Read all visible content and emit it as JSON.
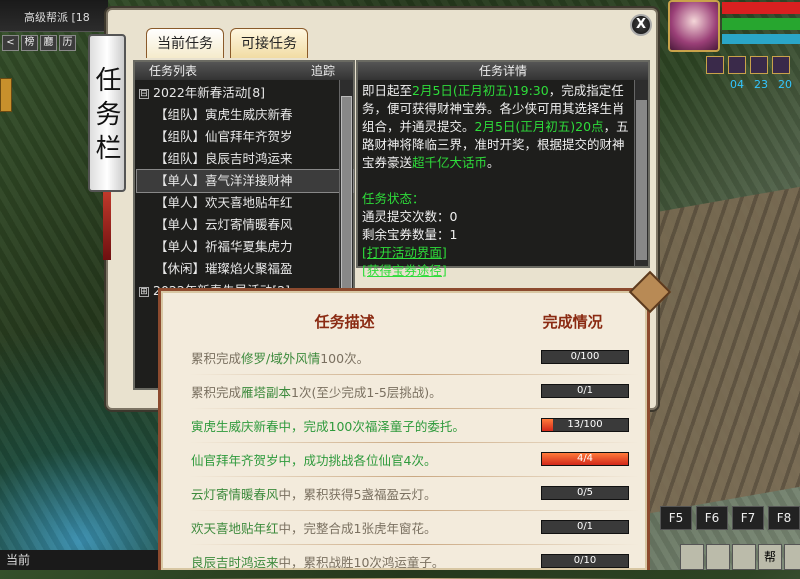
{
  "topbar": {
    "guild": "高级帮派 [18"
  },
  "toolrow": {
    "b1": "<",
    "b2": "榜",
    "b3": "廳",
    "b4": "历"
  },
  "window": {
    "title_scroll": "任务栏",
    "close": "X"
  },
  "tabs": [
    {
      "label": "当前任务"
    },
    {
      "label": "可接任务"
    }
  ],
  "list": {
    "header_left": "任务列表",
    "header_right": "追踪",
    "rows": [
      {
        "label": "2022年新春活动[8]",
        "expander": "⊟"
      },
      {
        "label": "【组队】寅虎生威庆新春"
      },
      {
        "label": "【组队】仙官拜年齐贺岁"
      },
      {
        "label": "【组队】良辰吉时鸿运来"
      },
      {
        "label": "【单人】喜气洋洋接财神"
      },
      {
        "label": "【单人】欢天喜地贴年红"
      },
      {
        "label": "【单人】云灯寄情暖春风"
      },
      {
        "label": "【单人】祈福华夏集虎力"
      },
      {
        "label": "【休闲】璀璨焰火聚福盈"
      },
      {
        "label": "2022年新春先导活动[2]",
        "expander": "⊞"
      }
    ]
  },
  "details": {
    "header": "任务详情",
    "p1a": "即日起至",
    "p1b": "2月5日(正月初五)19:30",
    "p1c": "，完成指定任务，便可获得财神宝券。各少侠可用其选择生肖组合，并通灵提交。",
    "p1d": "2月5日(正月初五)20点",
    "p1e": "，五路财神将降临三界，准时开奖，根据提交的财神宝券豪送",
    "p1f": "超千亿大话币",
    "p1g": "。",
    "status_label": "任务状态：",
    "s1": "通灵提交次数：0",
    "s2": "剩余宝券数量：1",
    "link1": "[打开活动界面]",
    "link2": "[获得宝券途径]"
  },
  "popup": {
    "col_desc": "任务描述",
    "col_status": "完成情况",
    "rows": [
      {
        "pre": "累积完成",
        "hl": "修罗/域外风情",
        "post": "100次。",
        "progress": "0/100",
        "frac": 0
      },
      {
        "pre": "累积完成",
        "hl": "雁塔副本",
        "post": "1次(至少完成1-5层挑战)。",
        "progress": "0/1",
        "frac": 0
      },
      {
        "pre": "",
        "hl": "寅虎生威庆新春",
        "post": "中，完成100次福泽童子的委托。",
        "progress": "13/100",
        "frac": 0.13,
        "done": true
      },
      {
        "pre": "",
        "hl": "仙官拜年齐贺岁",
        "post": "中，成功挑战各位仙官4次。",
        "progress": "4/4",
        "frac": 1,
        "done": true
      },
      {
        "pre": "",
        "hl": "云灯寄情暖春风",
        "post": "中，累积获得5盏福盈云灯。",
        "progress": "0/5",
        "frac": 0
      },
      {
        "pre": "",
        "hl": "欢天喜地贴年红",
        "post": "中，完整合成1张虎年窗花。",
        "progress": "0/1",
        "frac": 0
      },
      {
        "pre": "",
        "hl": "良辰吉时鸿运来",
        "post": "中，累积战胜10次鸿运童子。",
        "progress": "0/10",
        "frac": 0
      }
    ]
  },
  "hud": {
    "n1": "04",
    "n2": "23",
    "n3": "20",
    "f5": "F5",
    "f6": "F6",
    "f7": "F7",
    "f8": "F8",
    "bottom_left": "当前",
    "bang": "帮"
  }
}
